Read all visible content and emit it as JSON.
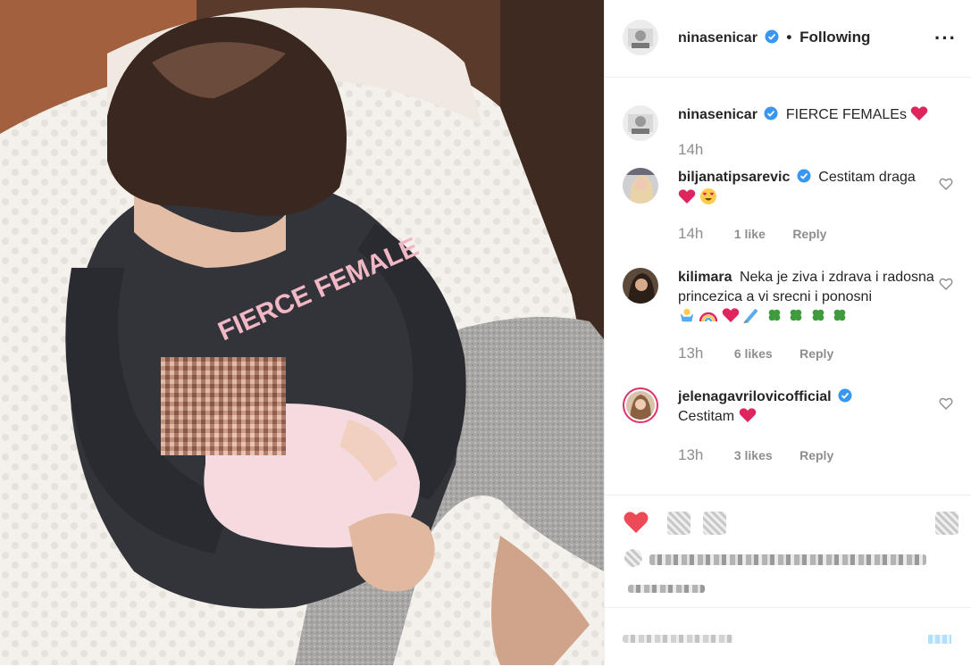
{
  "post": {
    "owner": {
      "username": "ninasenicar",
      "verified": true,
      "follow_status": "Following"
    },
    "more_options_icon": "more-horizontal-icon",
    "caption": {
      "username": "ninasenicar",
      "text": "FIERCE FEMALEs",
      "emoji": "heart",
      "time": "14h"
    },
    "photo_print": "FIERCE FEMALE"
  },
  "comments": [
    {
      "username": "biljanatipsarevic",
      "verified": true,
      "text": "Cestitam draga",
      "time": "14h",
      "likes": "1 like",
      "reply": "Reply"
    },
    {
      "username": "kilimara",
      "verified": false,
      "text": "Neka je ziva i zdrava i radosna princezica a vi srecni i ponosni",
      "time": "13h",
      "likes": "6 likes",
      "reply": "Reply"
    },
    {
      "username": "jelenagavrilovicofficial",
      "verified": true,
      "text": "Cestitam",
      "time": "13h",
      "likes": "3 likes",
      "reply": "Reply"
    }
  ],
  "colors": {
    "verified_blue": "#3897f0",
    "like_red": "#ed4956",
    "story_ring": "#e1306c",
    "muted_text": "#8e8e8e"
  }
}
